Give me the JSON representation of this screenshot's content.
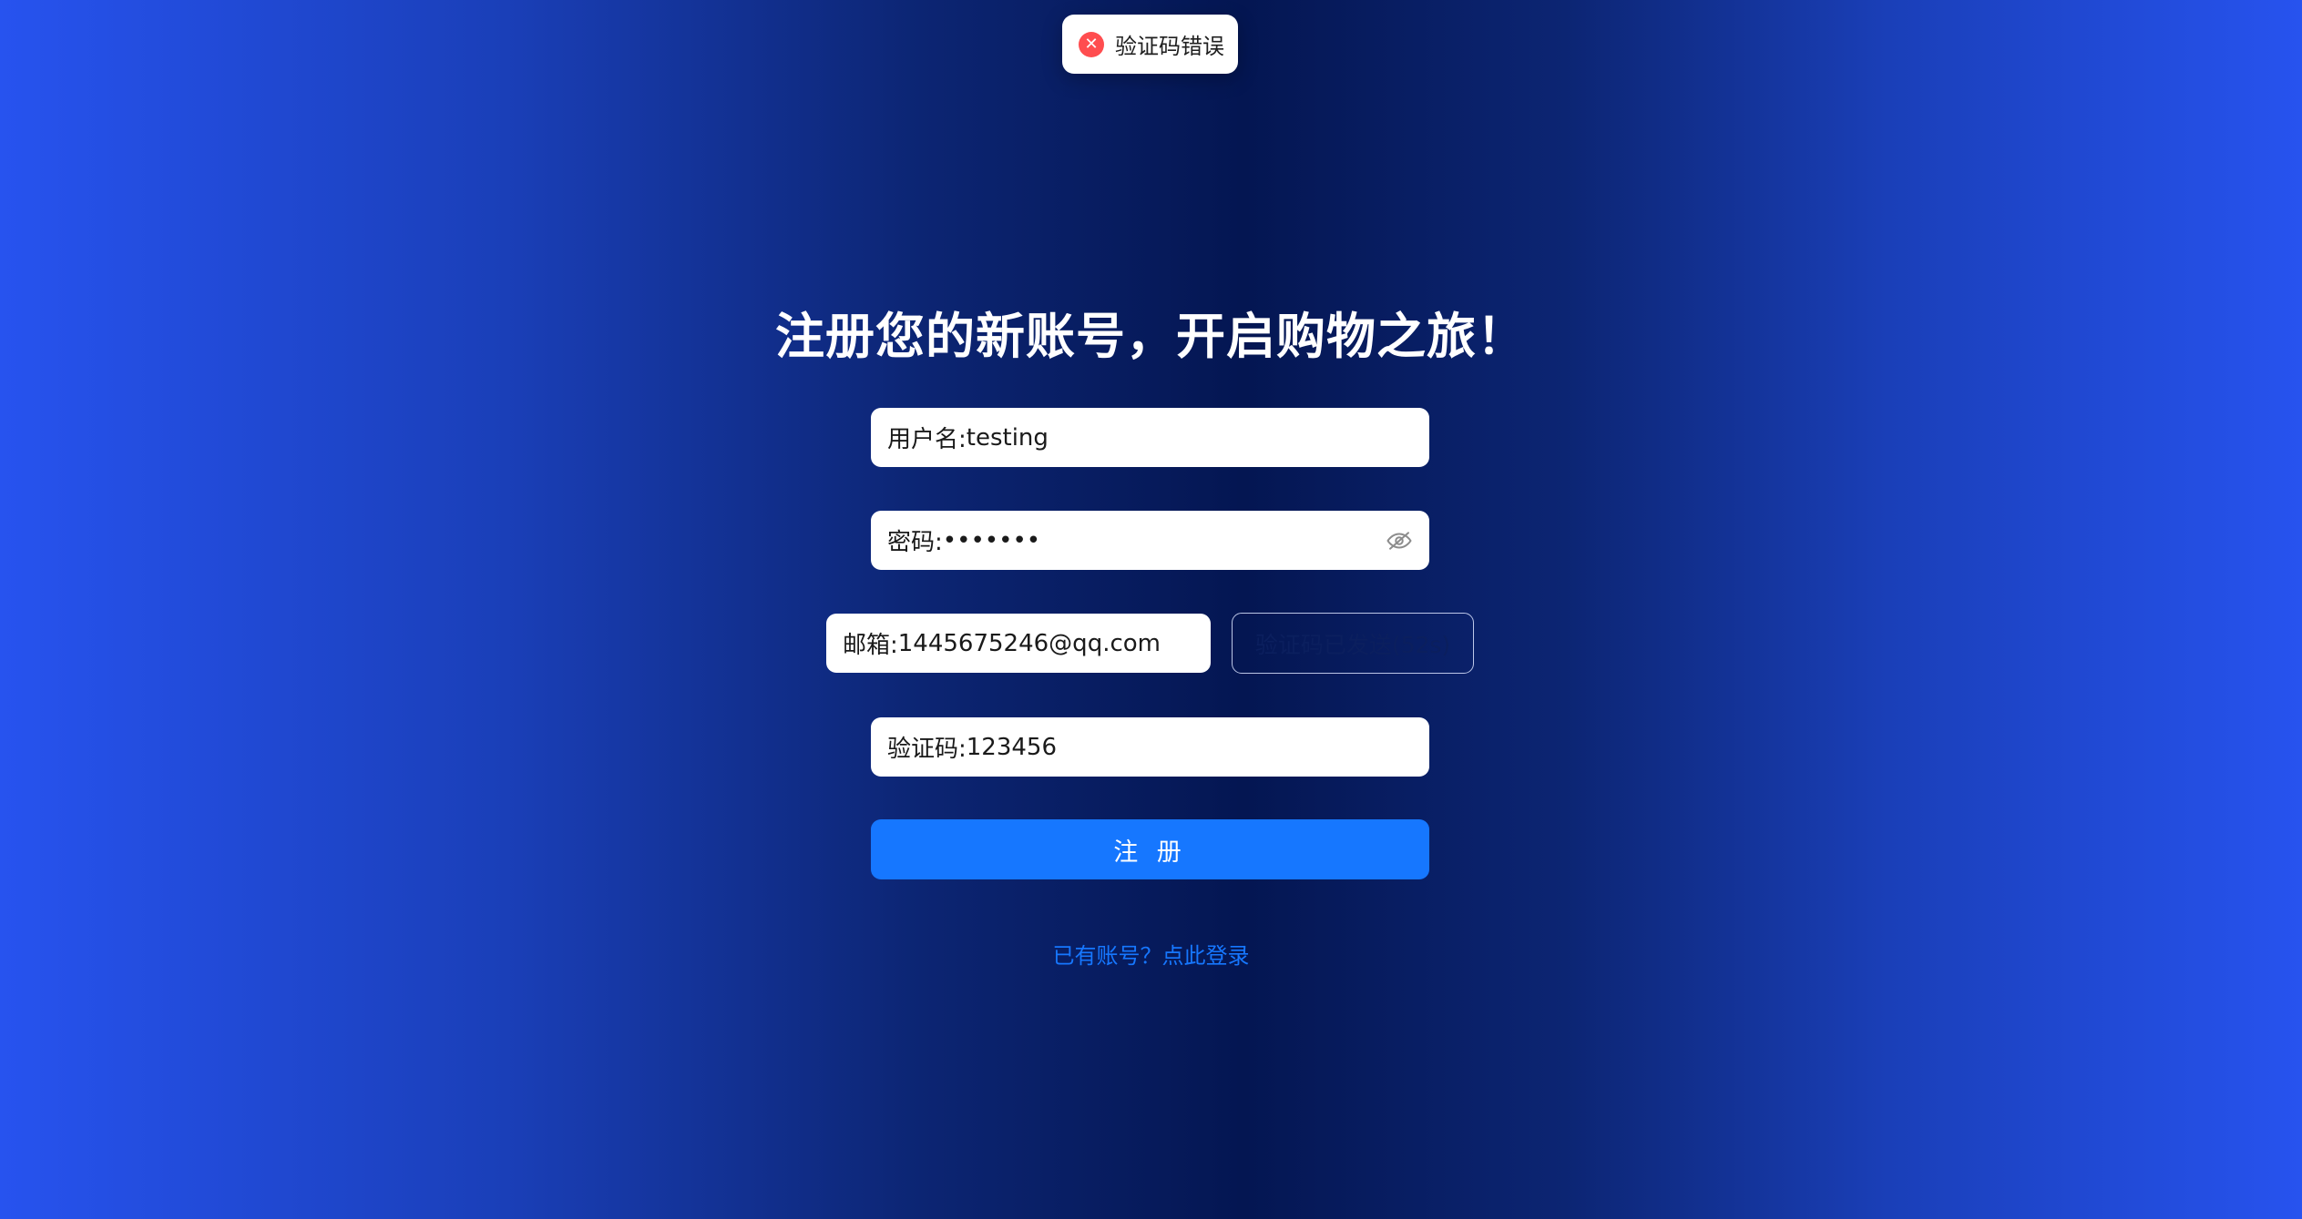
{
  "toast": {
    "icon": "close-circle-icon",
    "message": "验证码错误",
    "color": "#ff4d4f"
  },
  "page": {
    "title": "注册您的新账号，开启购物之旅！"
  },
  "form": {
    "username": {
      "label": "用户名: ",
      "value": "testing"
    },
    "password": {
      "label": "密码: ",
      "value": "•••••••",
      "toggle_icon": "eye-invisible-icon"
    },
    "email": {
      "label": "邮箱: ",
      "value": "1445675246@qq.com"
    },
    "send_code_button": "验证码已发送(52s)",
    "code": {
      "label": "验证码: ",
      "value": "123456"
    },
    "submit_label": "注 册",
    "login_link": "已有账号？点此登录"
  },
  "colors": {
    "primary": "#1677ff",
    "error": "#ff4d4f",
    "background_edge": "#2753ef",
    "background_center": "#041652"
  }
}
